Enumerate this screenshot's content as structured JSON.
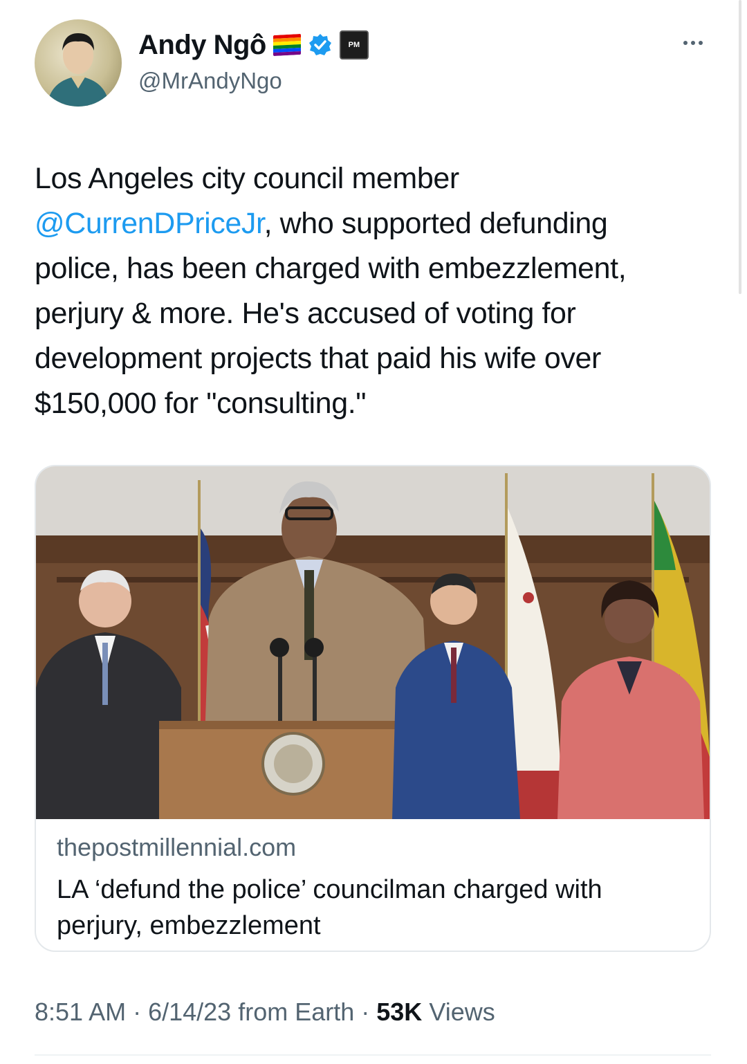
{
  "author": {
    "display_name": "Andy Ngô",
    "handle": "@MrAndyNgo",
    "avatar_icon": "portrait-avatar",
    "badges": [
      "rainbow-flag-icon",
      "verified-badge-icon",
      "affiliate-badge-icon"
    ],
    "affiliate_badge_text": "PM"
  },
  "tweet": {
    "text_before": "Los Angeles city council member\n",
    "mention": "@CurrenDPriceJr",
    "text_after": ", who supported defunding\npolice, has been charged with embezzlement,\nperjury & more. He's accused of voting for\ndevelopment projects that paid his wife over\n$150,000 for \"consulting.\""
  },
  "link_card": {
    "domain": "thepostmillennial.com",
    "title": "LA ‘defund the police’ councilman charged with perjury, embezzlement"
  },
  "meta": {
    "time": "8:51 AM",
    "sep1": "·",
    "date": "6/14/23",
    "source": "from Earth",
    "sep2": "·",
    "views_count": "53K",
    "views_label": "Views"
  },
  "colors": {
    "accent": "#1d9bf0",
    "text_primary": "#0f1419",
    "text_secondary": "#536471"
  }
}
